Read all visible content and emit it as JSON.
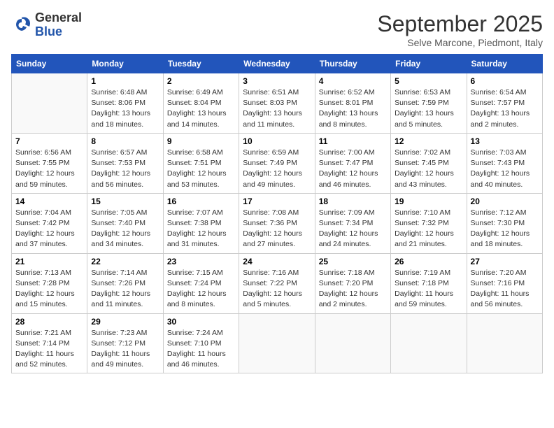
{
  "logo": {
    "general": "General",
    "blue": "Blue"
  },
  "title": "September 2025",
  "subtitle": "Selve Marcone, Piedmont, Italy",
  "days_of_week": [
    "Sunday",
    "Monday",
    "Tuesday",
    "Wednesday",
    "Thursday",
    "Friday",
    "Saturday"
  ],
  "weeks": [
    [
      {
        "num": "",
        "info": ""
      },
      {
        "num": "1",
        "info": "Sunrise: 6:48 AM\nSunset: 8:06 PM\nDaylight: 13 hours\nand 18 minutes."
      },
      {
        "num": "2",
        "info": "Sunrise: 6:49 AM\nSunset: 8:04 PM\nDaylight: 13 hours\nand 14 minutes."
      },
      {
        "num": "3",
        "info": "Sunrise: 6:51 AM\nSunset: 8:03 PM\nDaylight: 13 hours\nand 11 minutes."
      },
      {
        "num": "4",
        "info": "Sunrise: 6:52 AM\nSunset: 8:01 PM\nDaylight: 13 hours\nand 8 minutes."
      },
      {
        "num": "5",
        "info": "Sunrise: 6:53 AM\nSunset: 7:59 PM\nDaylight: 13 hours\nand 5 minutes."
      },
      {
        "num": "6",
        "info": "Sunrise: 6:54 AM\nSunset: 7:57 PM\nDaylight: 13 hours\nand 2 minutes."
      }
    ],
    [
      {
        "num": "7",
        "info": "Sunrise: 6:56 AM\nSunset: 7:55 PM\nDaylight: 12 hours\nand 59 minutes."
      },
      {
        "num": "8",
        "info": "Sunrise: 6:57 AM\nSunset: 7:53 PM\nDaylight: 12 hours\nand 56 minutes."
      },
      {
        "num": "9",
        "info": "Sunrise: 6:58 AM\nSunset: 7:51 PM\nDaylight: 12 hours\nand 53 minutes."
      },
      {
        "num": "10",
        "info": "Sunrise: 6:59 AM\nSunset: 7:49 PM\nDaylight: 12 hours\nand 49 minutes."
      },
      {
        "num": "11",
        "info": "Sunrise: 7:00 AM\nSunset: 7:47 PM\nDaylight: 12 hours\nand 46 minutes."
      },
      {
        "num": "12",
        "info": "Sunrise: 7:02 AM\nSunset: 7:45 PM\nDaylight: 12 hours\nand 43 minutes."
      },
      {
        "num": "13",
        "info": "Sunrise: 7:03 AM\nSunset: 7:43 PM\nDaylight: 12 hours\nand 40 minutes."
      }
    ],
    [
      {
        "num": "14",
        "info": "Sunrise: 7:04 AM\nSunset: 7:42 PM\nDaylight: 12 hours\nand 37 minutes."
      },
      {
        "num": "15",
        "info": "Sunrise: 7:05 AM\nSunset: 7:40 PM\nDaylight: 12 hours\nand 34 minutes."
      },
      {
        "num": "16",
        "info": "Sunrise: 7:07 AM\nSunset: 7:38 PM\nDaylight: 12 hours\nand 31 minutes."
      },
      {
        "num": "17",
        "info": "Sunrise: 7:08 AM\nSunset: 7:36 PM\nDaylight: 12 hours\nand 27 minutes."
      },
      {
        "num": "18",
        "info": "Sunrise: 7:09 AM\nSunset: 7:34 PM\nDaylight: 12 hours\nand 24 minutes."
      },
      {
        "num": "19",
        "info": "Sunrise: 7:10 AM\nSunset: 7:32 PM\nDaylight: 12 hours\nand 21 minutes."
      },
      {
        "num": "20",
        "info": "Sunrise: 7:12 AM\nSunset: 7:30 PM\nDaylight: 12 hours\nand 18 minutes."
      }
    ],
    [
      {
        "num": "21",
        "info": "Sunrise: 7:13 AM\nSunset: 7:28 PM\nDaylight: 12 hours\nand 15 minutes."
      },
      {
        "num": "22",
        "info": "Sunrise: 7:14 AM\nSunset: 7:26 PM\nDaylight: 12 hours\nand 11 minutes."
      },
      {
        "num": "23",
        "info": "Sunrise: 7:15 AM\nSunset: 7:24 PM\nDaylight: 12 hours\nand 8 minutes."
      },
      {
        "num": "24",
        "info": "Sunrise: 7:16 AM\nSunset: 7:22 PM\nDaylight: 12 hours\nand 5 minutes."
      },
      {
        "num": "25",
        "info": "Sunrise: 7:18 AM\nSunset: 7:20 PM\nDaylight: 12 hours\nand 2 minutes."
      },
      {
        "num": "26",
        "info": "Sunrise: 7:19 AM\nSunset: 7:18 PM\nDaylight: 11 hours\nand 59 minutes."
      },
      {
        "num": "27",
        "info": "Sunrise: 7:20 AM\nSunset: 7:16 PM\nDaylight: 11 hours\nand 56 minutes."
      }
    ],
    [
      {
        "num": "28",
        "info": "Sunrise: 7:21 AM\nSunset: 7:14 PM\nDaylight: 11 hours\nand 52 minutes."
      },
      {
        "num": "29",
        "info": "Sunrise: 7:23 AM\nSunset: 7:12 PM\nDaylight: 11 hours\nand 49 minutes."
      },
      {
        "num": "30",
        "info": "Sunrise: 7:24 AM\nSunset: 7:10 PM\nDaylight: 11 hours\nand 46 minutes."
      },
      {
        "num": "",
        "info": ""
      },
      {
        "num": "",
        "info": ""
      },
      {
        "num": "",
        "info": ""
      },
      {
        "num": "",
        "info": ""
      }
    ]
  ]
}
